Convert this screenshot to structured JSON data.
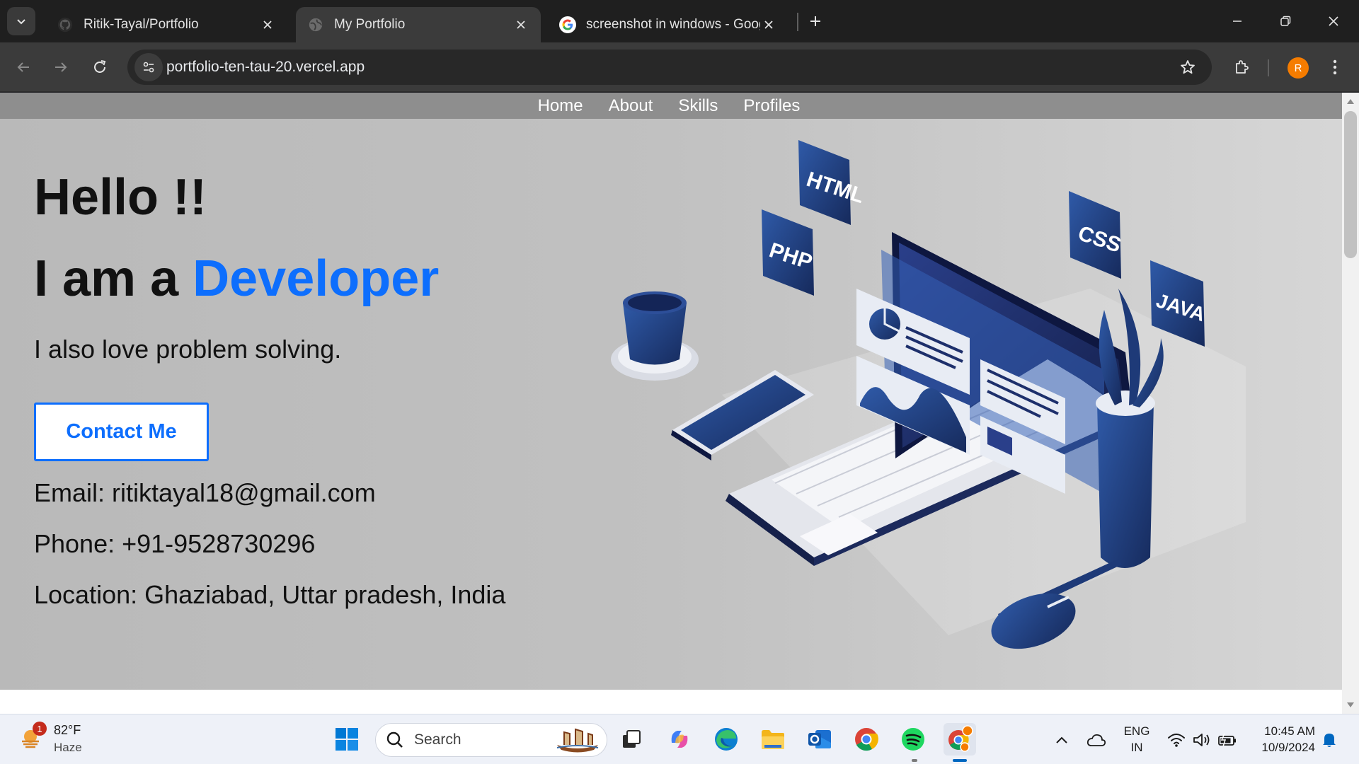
{
  "browser": {
    "tabs": [
      {
        "title": "Ritik-Tayal/Portfolio",
        "favicon": "github-icon"
      },
      {
        "title": "My Portfolio",
        "favicon": "globe-icon",
        "active": true
      },
      {
        "title": "screenshot in windows - Google",
        "favicon": "google-icon"
      }
    ],
    "url": "portfolio-ten-tau-20.vercel.app",
    "profile_initial": "R"
  },
  "site": {
    "nav": [
      "Home",
      "About",
      "Skills",
      "Profiles"
    ],
    "hero": {
      "greeting": "Hello !!",
      "intro_prefix": "I am a ",
      "role": "Developer",
      "tagline": "I also love problem solving.",
      "cta": "Contact Me",
      "email": "Email: ritiktayal18@gmail.com",
      "phone": "Phone: +91-9528730296",
      "location": "Location: Ghaziabad, Uttar pradesh, India"
    },
    "illustration_tags": [
      "HTML",
      "PHP",
      "CSS",
      "JAVA"
    ]
  },
  "taskbar": {
    "weather": {
      "temp": "82°F",
      "condition": "Haze",
      "badge": "1"
    },
    "search_placeholder": "Search",
    "lang": {
      "line1": "ENG",
      "line2": "IN"
    },
    "clock": {
      "time": "10:45 AM",
      "date": "10/9/2024"
    }
  },
  "colors": {
    "accent": "#0d6efd",
    "nav_bg": "#8e8e8e",
    "illustration_navy": "#1e3a78"
  }
}
